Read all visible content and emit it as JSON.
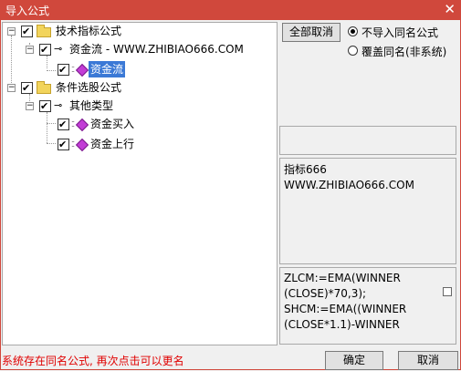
{
  "window": {
    "title": "导入公式",
    "close_glyph": "✕"
  },
  "tree": {
    "group1": {
      "label": "技术指标公式"
    },
    "item1": {
      "label": "资金流 - WWW.ZHIBIAO666.COM"
    },
    "item1_child": {
      "label": "资金流"
    },
    "group2": {
      "label": "条件选股公式"
    },
    "item2": {
      "label": "其他类型"
    },
    "item2_child1": {
      "label": "资金买入"
    },
    "item2_child2": {
      "label": "资金上行"
    }
  },
  "controls": {
    "cancel_all_label": "全部取消",
    "radio_skip_label": "不导入同名公式",
    "radio_overwrite_label": "覆盖同名(非系统)"
  },
  "info": {
    "line1": "指标666",
    "line2": "WWW.ZHIBIAO666.COM"
  },
  "formula": {
    "line1": "ZLCM:=EMA(WINNER",
    "line2": "(CLOSE)*70,3);",
    "line3": "SHCM:=EMA((WINNER",
    "line4": "(CLOSE*1.1)-WINNER"
  },
  "status_text": "系统存在同名公式, 再次点击可以更名",
  "buttons": {
    "ok_label": "确定",
    "cancel_label": "取消"
  },
  "icons": {
    "folder": "folder-icon",
    "key": "key-icon",
    "formula": "formula-diamond-icon",
    "checkbox": "checkbox-icon"
  },
  "colors": {
    "titlebar": "#d0483c",
    "selection": "#3b79d6",
    "status": "#e00000"
  }
}
